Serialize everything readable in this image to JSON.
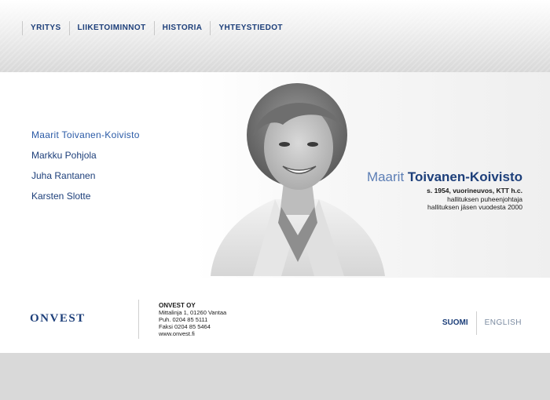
{
  "nav": {
    "items": [
      "YRITYS",
      "LIIKETOIMINNOT",
      "HISTORIA",
      "YHTEYSTIEDOT"
    ]
  },
  "people": {
    "items": [
      "Maarit Toivanen-Koivisto",
      "Markku Pohjola",
      "Juha Rantanen",
      "Karsten Slotte"
    ],
    "active_index": 0
  },
  "caption": {
    "first_name": "Maarit",
    "last_name": "Toivanen-Koivisto",
    "line1": "s. 1954, vuorineuvos, KTT h.c.",
    "line2": "hallituksen puheenjohtaja",
    "line3": "hallituksen jäsen vuodesta 2000"
  },
  "footer": {
    "logo_text": "ONVEST",
    "company_name": "ONVEST OY",
    "address": "Mittalinja 1, 01260 Vantaa",
    "phone": "Puh. 0204 85 5111",
    "fax": "Faksi 0204 85 5464",
    "website": "www.onvest.fi"
  },
  "language": {
    "suomi": "SUOMI",
    "english": "ENGLISH"
  },
  "colors": {
    "brand_blue": "#1d3f7a",
    "accent_blue": "#5c7eb5"
  }
}
